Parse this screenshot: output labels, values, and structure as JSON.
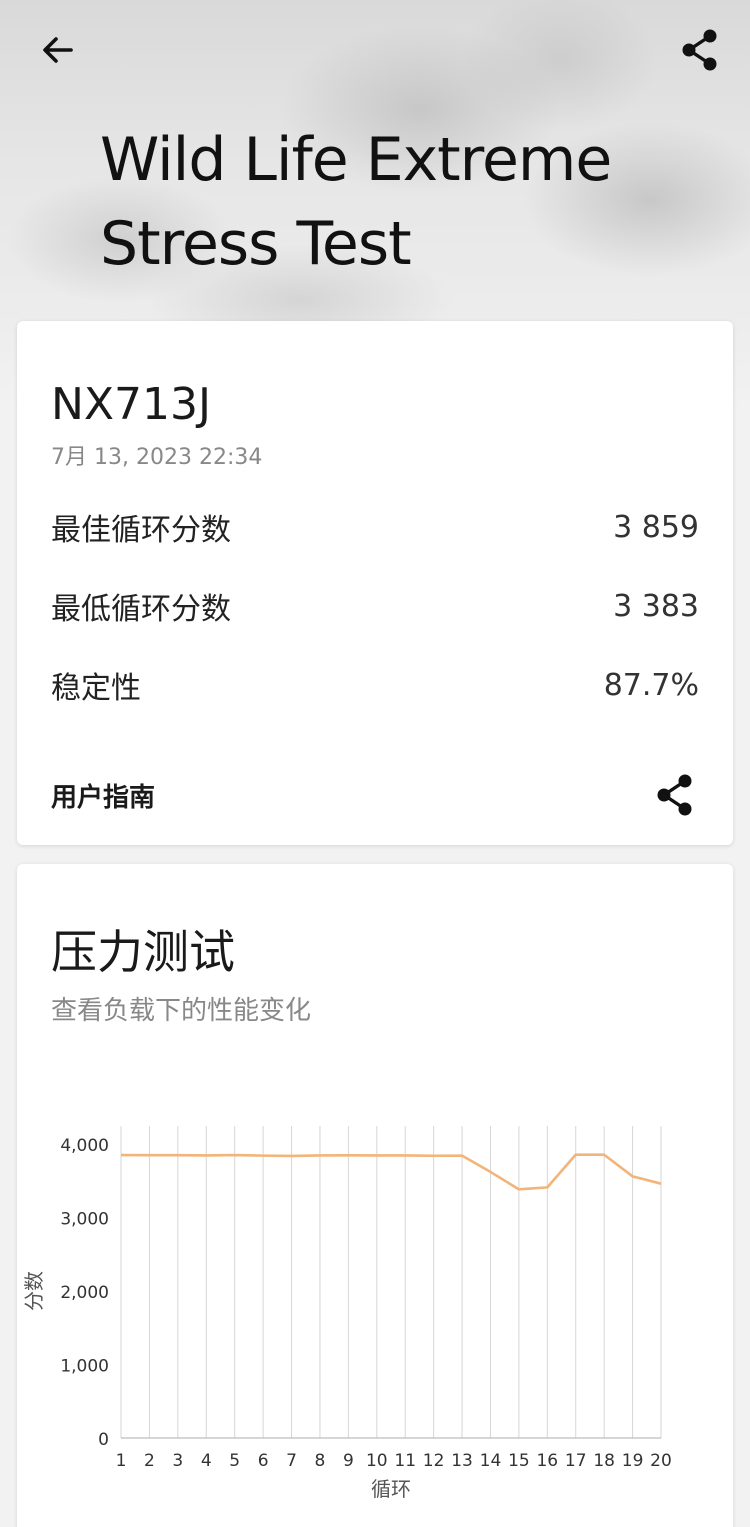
{
  "header": {
    "title_line1": "Wild Life Extreme",
    "title_line2": "Stress Test",
    "back_icon": "arrow-left-icon",
    "share_icon": "share-icon"
  },
  "result": {
    "device": "NX713J",
    "date": "7月 13, 2023 22:34",
    "rows": [
      {
        "label": "最佳循环分数",
        "value": "3 859"
      },
      {
        "label": "最低循环分数",
        "value": "3 383"
      },
      {
        "label": "稳定性",
        "value": "87.7%"
      }
    ],
    "guide_label": "用户指南"
  },
  "stress": {
    "title": "压力测试",
    "subtitle": "查看负载下的性能变化"
  },
  "chart_data": {
    "type": "line",
    "xlabel": "循环",
    "ylabel": "分数",
    "x": [
      1,
      2,
      3,
      4,
      5,
      6,
      7,
      8,
      9,
      10,
      11,
      12,
      13,
      14,
      15,
      16,
      17,
      18,
      19,
      20
    ],
    "values": [
      3850,
      3848,
      3848,
      3845,
      3849,
      3842,
      3838,
      3845,
      3846,
      3844,
      3845,
      3840,
      3842,
      3620,
      3383,
      3410,
      3855,
      3854,
      3560,
      3460
    ],
    "ylim": [
      0,
      4000
    ],
    "yticks": [
      0,
      1000,
      2000,
      3000,
      4000
    ],
    "ytick_labels": [
      "0",
      "1,000",
      "2,000",
      "3,000",
      "4,000"
    ],
    "grid": "vertical",
    "line_color": "#f2b47a"
  }
}
